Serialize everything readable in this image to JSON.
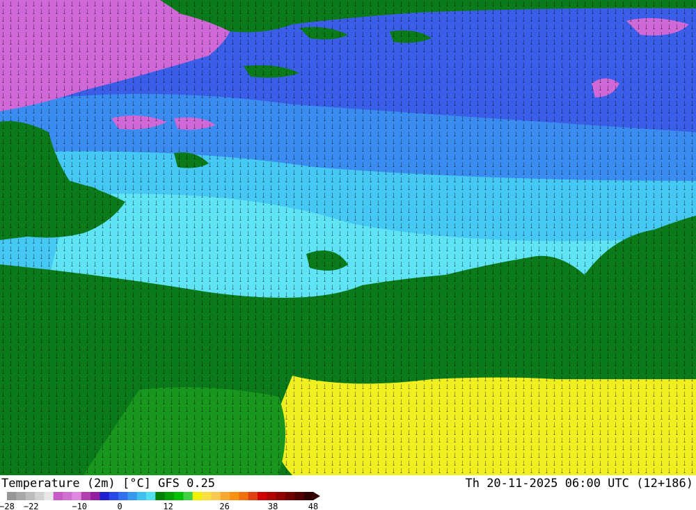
{
  "title": "Temperature (2m) [°C] GFS 0.25",
  "valid_time": "Th 20-11-2025 06:00 UTC (12+186)",
  "legend": {
    "ticks": [
      "-28",
      "-22",
      "-10",
      "0",
      "12",
      "26",
      "38",
      "48"
    ],
    "colors": [
      "#969696",
      "#a8a8a8",
      "#bcbcbc",
      "#d2d2d2",
      "#e8e8e8",
      "#c85ac8",
      "#d070d0",
      "#e088e0",
      "#b040b0",
      "#9020a0",
      "#2020d0",
      "#2848e8",
      "#3070f0",
      "#3898f0",
      "#40c0f0",
      "#50e0f0",
      "#008000",
      "#00a000",
      "#00c000",
      "#40d040",
      "#f0f000",
      "#f8e040",
      "#f8c850",
      "#f8a830",
      "#f89010",
      "#f07010",
      "#e04010",
      "#d00000",
      "#b00000",
      "#900000",
      "#700000",
      "#500000",
      "#300000"
    ]
  },
  "map": {
    "colors": {
      "land": "#0a7a1a",
      "land_warm": "#18961e",
      "sea_cold": "#3a5ee8",
      "sea_mid": "#3a8cf0",
      "sea_light": "#46c8f4",
      "sea_cyan": "#5ee4f4",
      "very_cold": "#d068d8",
      "warm": "#f0f020"
    }
  }
}
